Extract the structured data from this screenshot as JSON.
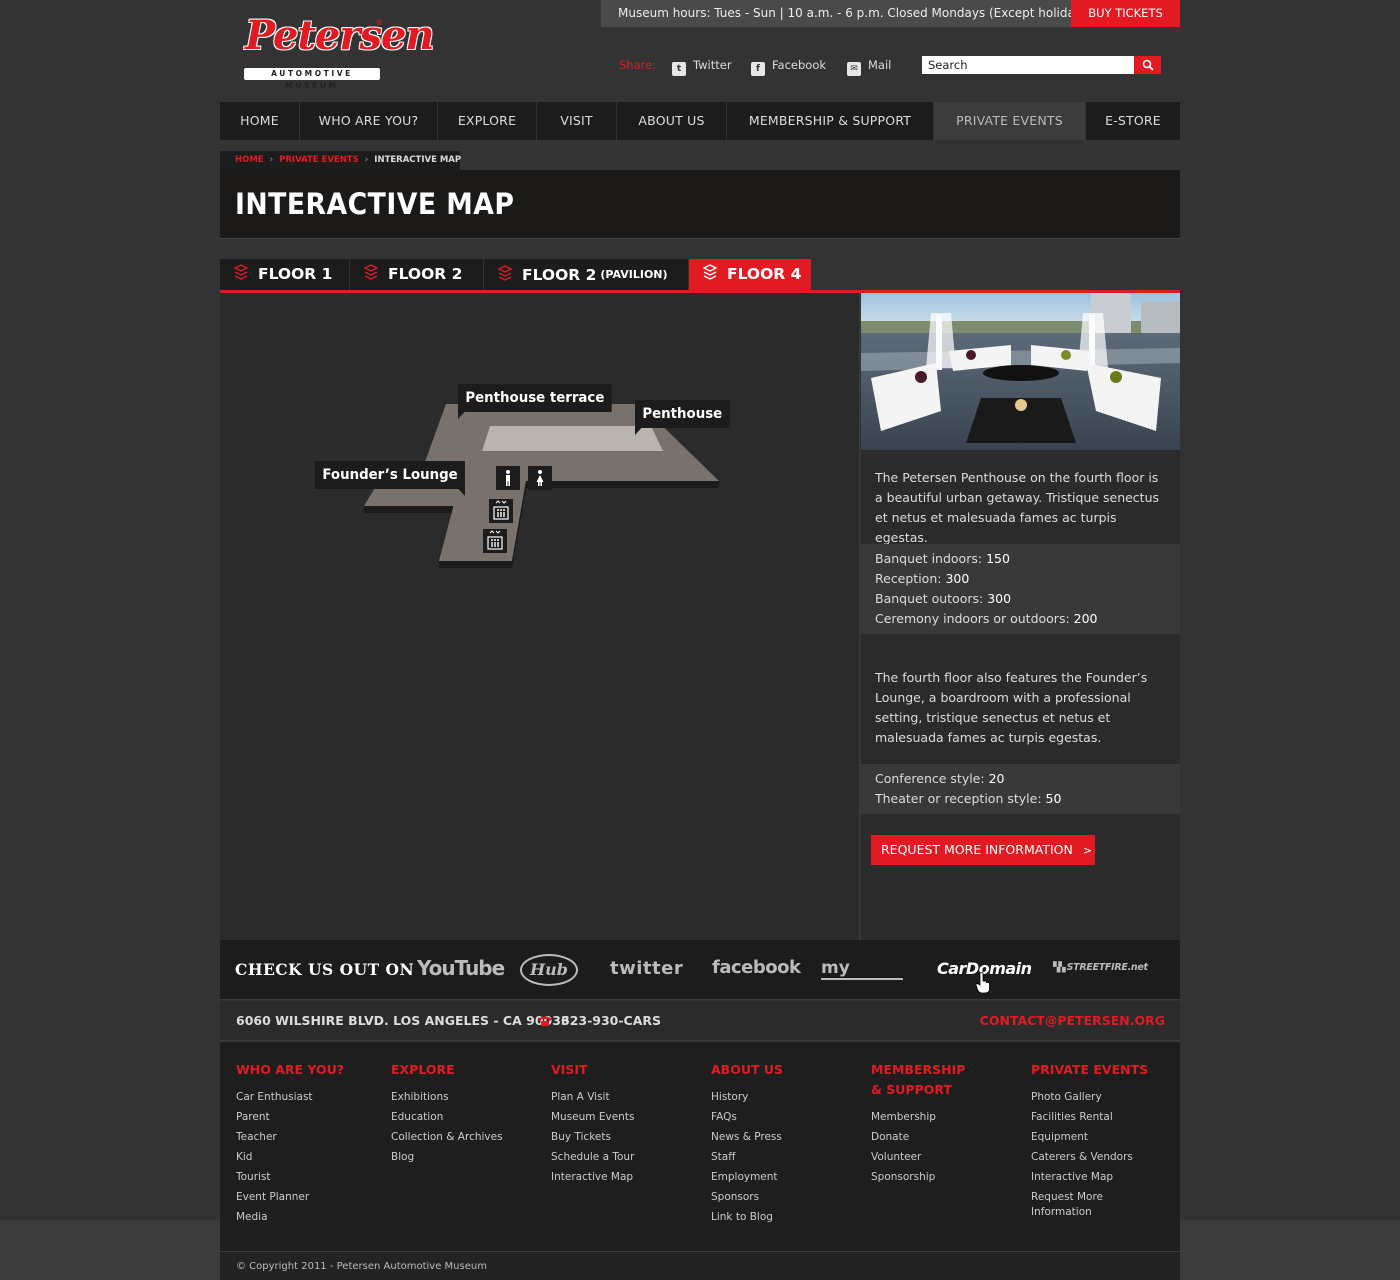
{
  "header": {
    "hours": "Museum hours: Tues - Sun | 10 a.m. - 6 p.m. Closed Mondays (Except holidays)",
    "buy_tickets": "BUY TICKETS",
    "logo_text": "Petersen",
    "logo_sub": "AUTOMOTIVE MUSEUM",
    "share_label": "Share:",
    "share_links": [
      "Twitter",
      "Facebook",
      "Mail"
    ],
    "search_placeholder": "Search",
    "search_value": "Search"
  },
  "nav": {
    "items": [
      "HOME",
      "WHO ARE YOU?",
      "EXPLORE",
      "VISIT",
      "ABOUT US",
      "MEMBERSHIP & SUPPORT",
      "PRIVATE EVENTS",
      "E-STORE"
    ],
    "active": "PRIVATE EVENTS"
  },
  "breadcrumb": [
    "HOME",
    "PRIVATE EVENTS",
    "INTERACTIVE MAP"
  ],
  "page_title": "INTERACTIVE MAP",
  "floor_tabs": [
    {
      "label": "FLOOR 1",
      "sub": ""
    },
    {
      "label": "FLOOR 2",
      "sub": ""
    },
    {
      "label": "FLOOR 2",
      "sub": "(PAVILION)"
    },
    {
      "label": "FLOOR 4",
      "sub": ""
    }
  ],
  "active_floor": "FLOOR 4",
  "map": {
    "labels": [
      "Penthouse terrace",
      "Penthouse",
      "Founder’s Lounge"
    ],
    "icons": [
      "mens-restroom-icon",
      "womens-restroom-icon",
      "elevator-icon",
      "elevator-icon"
    ]
  },
  "side": {
    "intro": "The Petersen Penthouse on the fourth floor is a beautiful urban getaway. Tristique senectus et netus et malesuada fames ac turpis egestas.",
    "capacities_1": [
      {
        "label": "Banquet indoors:",
        "value": "150"
      },
      {
        "label": "Reception:",
        "value": "300"
      },
      {
        "label": "Banquet outoors:",
        "value": "300"
      },
      {
        "label": "Ceremony indoors or outdoors:",
        "value": "200"
      }
    ],
    "lounge": "The fourth floor also features the Founder’s Lounge, a boardroom with a professional setting, tristique senectus et netus et malesuada fames ac turpis egestas.",
    "capacities_2": [
      {
        "label": "Conference style:",
        "value": "20"
      },
      {
        "label": "Theater or reception style:",
        "value": "50"
      }
    ],
    "request_button": "REQUEST MORE INFORMATION"
  },
  "social": {
    "title": "CHECK US OUT ON",
    "sites": [
      "YouTube",
      "Hub",
      "twitter",
      "facebook",
      "my",
      "CarDomain",
      "STREETFIRE.net"
    ]
  },
  "contact": {
    "address": "6060 WILSHIRE BLVD. LOS ANGELES - CA 90036",
    "phone": "323-930-CARS",
    "email": "CONTACT@PETERSEN.ORG"
  },
  "footer": {
    "columns": [
      {
        "head": "WHO ARE YOU?",
        "links": [
          "Car Enthusiast",
          "Parent",
          "Teacher",
          "Kid",
          "Tourist",
          "Event Planner",
          "Media"
        ]
      },
      {
        "head": "EXPLORE",
        "links": [
          "Exhibitions",
          "Education",
          "Collection & Archives",
          "Blog"
        ]
      },
      {
        "head": "VISIT",
        "links": [
          "Plan A Visit",
          "Museum Events",
          "Buy Tickets",
          "Schedule a Tour",
          "Interactive Map"
        ]
      },
      {
        "head": "ABOUT US",
        "links": [
          "History",
          "FAQs",
          "News & Press",
          "Staff",
          "Employment",
          "Sponsors",
          "Link to Blog"
        ]
      },
      {
        "head": "MEMBERSHIP & SUPPORT",
        "links": [
          "Membership",
          "Donate",
          "Volunteer",
          "Sponsorship"
        ]
      },
      {
        "head": "PRIVATE EVENTS",
        "links": [
          "Photo Gallery",
          "Facilities Rental",
          "Equipment",
          "Caterers & Vendors",
          "Interactive Map",
          "Request More Information"
        ]
      }
    ],
    "copyright": "© Copyright 2011 - Petersen Automotive Museum"
  },
  "colors": {
    "accent": "#e21b23",
    "background": "#333333",
    "panel": "#1c1c1c"
  }
}
